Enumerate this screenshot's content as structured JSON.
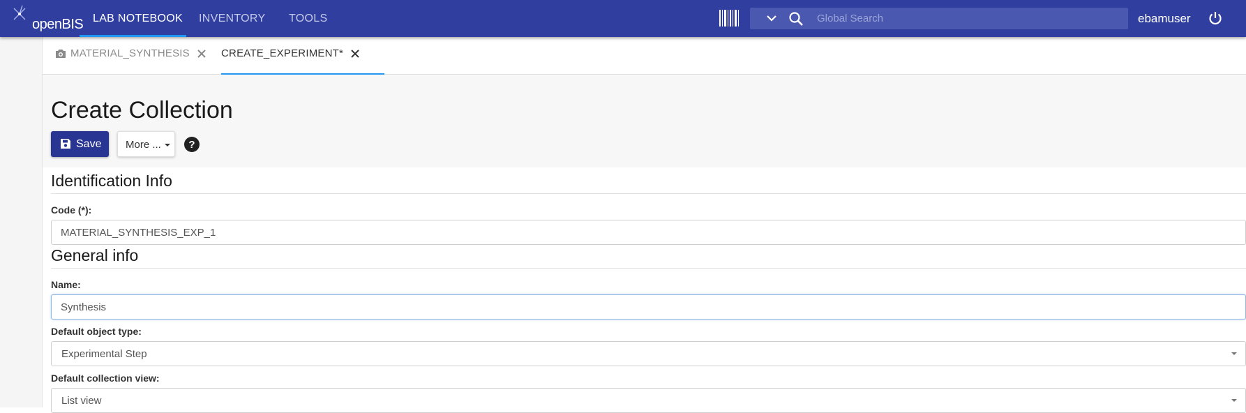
{
  "app": {
    "logo_text": "openBIS",
    "username": "ebamuser"
  },
  "nav": {
    "items": [
      {
        "label": "LAB NOTEBOOK",
        "active": true
      },
      {
        "label": "INVENTORY",
        "active": false
      },
      {
        "label": "TOOLS",
        "active": false
      }
    ]
  },
  "search": {
    "placeholder": "Global Search",
    "value": ""
  },
  "tabs": [
    {
      "label": "MATERIAL_SYNTHESIS",
      "icon": "camera-icon",
      "active": false
    },
    {
      "label": "CREATE_EXPERIMENT*",
      "active": true
    }
  ],
  "page": {
    "title": "Create Collection"
  },
  "toolbar": {
    "save_label": "Save",
    "more_label": "More ..."
  },
  "sections": {
    "identification": {
      "title": "Identification Info"
    },
    "general": {
      "title": "General info"
    }
  },
  "fields": {
    "code": {
      "label": "Code (*):",
      "value": "MATERIAL_SYNTHESIS_EXP_1"
    },
    "name": {
      "label": "Name:",
      "value": "Synthesis"
    },
    "default_object_type": {
      "label": "Default object type:",
      "value": "Experimental Step"
    },
    "default_collection_view": {
      "label": "Default collection view:",
      "value": "List view"
    }
  },
  "colors": {
    "topbar": "#303f9f",
    "accent": "#2196f3",
    "save_button": "#283593"
  }
}
